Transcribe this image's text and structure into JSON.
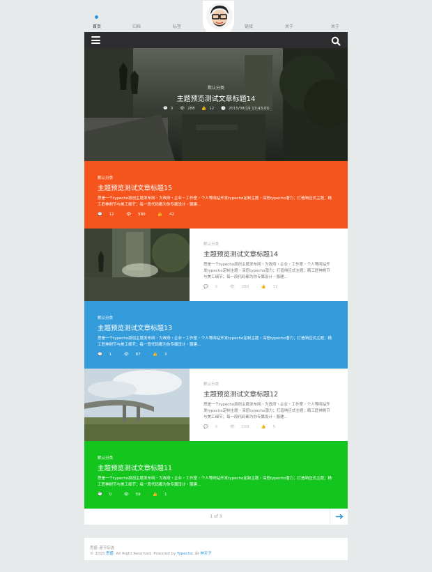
{
  "nav": {
    "items": [
      "首页",
      "归档",
      "标签",
      "链接",
      "关于",
      "关于"
    ],
    "active": 0
  },
  "toolbar": {
    "menu_icon": "menu-icon",
    "search_icon": "search-icon"
  },
  "hero": {
    "category": "默认分类",
    "title": "主题预览测试文章标题14",
    "comments": "0",
    "views": "288",
    "likes": "12",
    "date": "2015/08/19 13:43:00"
  },
  "posts": [
    {
      "category": "默认分类",
      "title": "主题预览测试文章标题15",
      "excerpt": "思是一个typecho原创主题发布网・为政府・企业・工作室・个人等网站开发typecho定制主题・深挖typecho潜力；打造响应式主题；精工匠神刷节与美工细节；每一段代码都为你专属设计・服建...",
      "comments": "12",
      "views": "580",
      "likes": "42",
      "color": "#f5551d"
    },
    {
      "category": "默认分类",
      "title": "主题预览测试文章标题14",
      "excerpt": "思是一个typecho原创主题发布网・为政府・企业・工作室・个人等网站开发typecho定制主题・深挖typecho潜力；打造响应式主题；精工匠神刷节与美工细节；每一段代码都为你专属设计・服建...",
      "comments": "0",
      "views": "288",
      "likes": "12"
    },
    {
      "category": "默认分类",
      "title": "主题预览测试文章标题13",
      "excerpt": "思是一个typecho原创主题发布网・为政府・企业・工作室・个人等网站开发typecho定制主题・深挖typecho潜力；打造响应式主题；精工匠神刷节与美工细节；每一段代码都为你专属设计・服建...",
      "comments": "1",
      "views": "87",
      "likes": "3",
      "color": "#349cdb"
    },
    {
      "category": "默认分类",
      "title": "主题预览测试文章标题12",
      "excerpt": "思是一个typecho原创主题发布网・为政府・企业・工作室・个人等网站开发typecho定制主题・深挖typecho潜力；打造响应式主题；精工匠神刷节与美工细节；每一段代码都为你专属设计・服建...",
      "comments": "0",
      "views": "108",
      "likes": "5"
    },
    {
      "category": "默认分类",
      "title": "主题预览测试文章标题11",
      "excerpt": "思是一个typecho原创主题发布网・为政府・企业・工作室・个人等网站开发typecho定制主题・深挖typecho潜力；打造响应式主题；精工匠神刷节与美工细节；每一段代码都为你专属设计・服建...",
      "comments": "0",
      "views": "59",
      "likes": "1",
      "color": "#13c51d"
    }
  ],
  "pager": {
    "text": "1 of 3",
    "next_icon": "arrow-right-icon"
  },
  "footer": {
    "line1": "思盛-漫节综选",
    "copyright_prefix": "© 2015",
    "site_link": "思盛",
    "rights": ". All Right Reserved. Powered by",
    "typecho": "Typecho",
    "by": ". 由",
    "author": "神天子"
  }
}
